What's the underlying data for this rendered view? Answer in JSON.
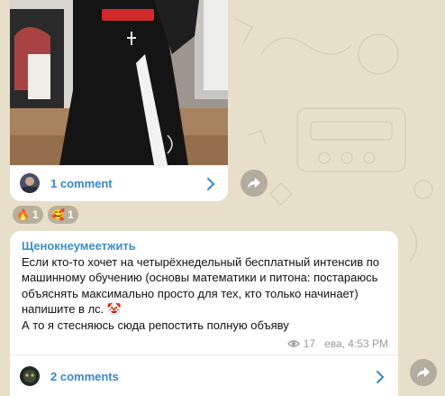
{
  "post1": {
    "comments_label": "1 comment",
    "reactions": [
      {
        "icon": "fire-emoji",
        "emoji": "🔥",
        "count": "1"
      },
      {
        "icon": "heart-eyes-emoji",
        "emoji": "🥰",
        "count": "1"
      }
    ]
  },
  "post2": {
    "author": "Щенокнеумеетжить",
    "text_line1": "Если кто-то хочет на четырёхнедельный бесплатный интенсив по машинному обучению (основы математики и питона: постараюсь объяснять максимально просто для тех, кто только начинает) напишите в лс. 🤡",
    "text_line2": "А то я стесняюсь сюда репостить полную объяву",
    "views": "17",
    "time": "ева, 4:53 PM",
    "comments_label": "2 comments"
  },
  "colors": {
    "background": "#e7dfc9",
    "accent": "#3a86c8"
  },
  "icons": [
    "eye-icon",
    "chevron-right-icon",
    "share-icon"
  ]
}
